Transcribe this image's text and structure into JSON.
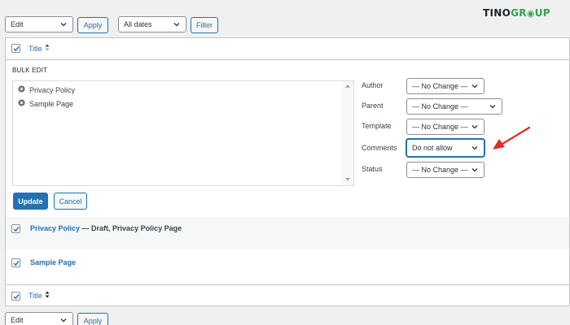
{
  "top_controls": {
    "bulk_action": "Edit",
    "apply_label": "Apply",
    "date_filter": "All dates",
    "filter_label": "Filter"
  },
  "brand": {
    "part1": "TINO",
    "part2": "GR",
    "part3": "UP"
  },
  "header_row": {
    "title_label": "Title"
  },
  "bulk_edit": {
    "heading": "BULK EDIT",
    "items": [
      "Privacy Policy",
      "Sample Page"
    ],
    "fields": {
      "author": {
        "label": "Author",
        "value": "— No Change —"
      },
      "parent": {
        "label": "Parent",
        "value": "— No Change —"
      },
      "template": {
        "label": "Template",
        "value": "— No Change —"
      },
      "comments": {
        "label": "Comments",
        "value": "Do not allow"
      },
      "status": {
        "label": "Status",
        "value": "— No Change —"
      }
    },
    "update_label": "Update",
    "cancel_label": "Cancel"
  },
  "rows": [
    {
      "title": "Privacy Policy",
      "suffix": " — Draft, Privacy Policy Page"
    },
    {
      "title": "Sample Page",
      "suffix": ""
    }
  ],
  "footer_row": {
    "title_label": "Title"
  },
  "bottom_controls": {
    "bulk_action": "Edit",
    "apply_label": "Apply"
  },
  "colors": {
    "accent": "#2271b1",
    "arrow": "#e02b20",
    "brand_dark": "#1d2327",
    "brand_green": "#2ea44f"
  }
}
